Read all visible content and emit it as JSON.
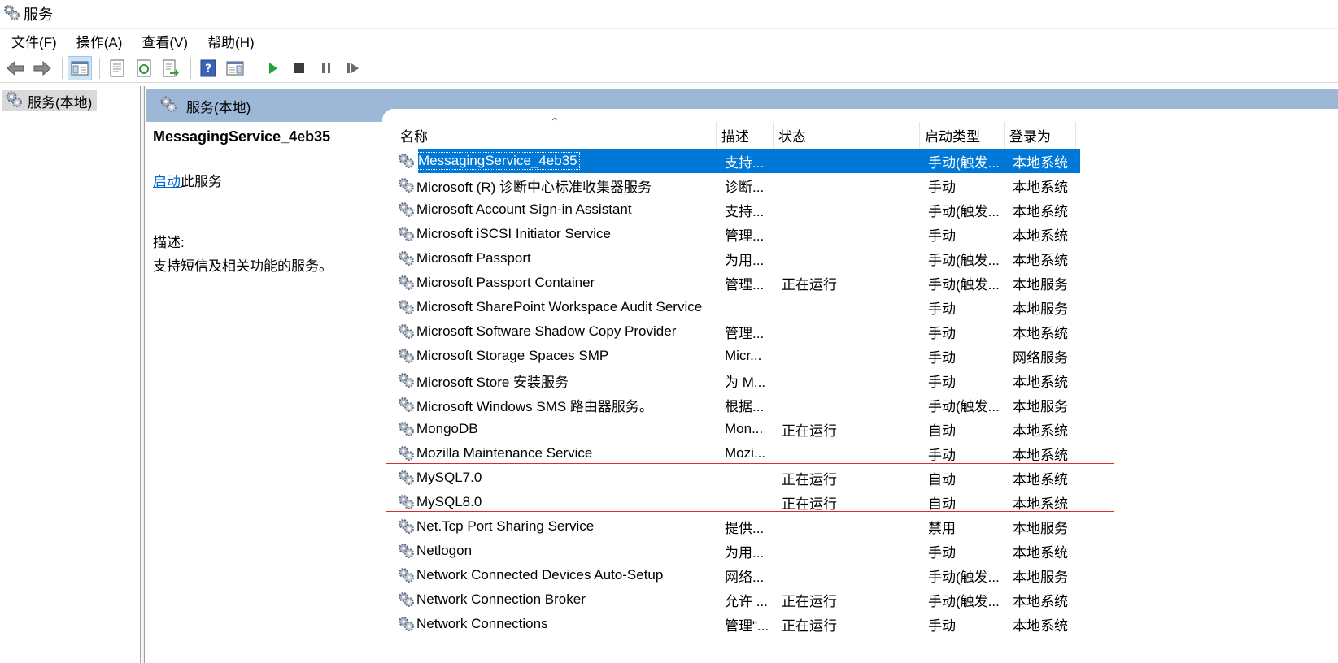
{
  "window": {
    "title": "服务"
  },
  "menu": [
    "文件(F)",
    "操作(A)",
    "查看(V)",
    "帮助(H)"
  ],
  "toolbar": [
    {
      "icon": "back-arrow-icon"
    },
    {
      "icon": "forward-arrow-icon"
    },
    {
      "icon": "show-hide-console-tree-icon"
    },
    {
      "icon": "properties-icon"
    },
    {
      "icon": "refresh-icon"
    },
    {
      "icon": "export-list-icon"
    },
    {
      "icon": "help-icon"
    },
    {
      "icon": "show-action-pane-icon"
    },
    {
      "icon": "start-service-icon"
    },
    {
      "icon": "stop-service-icon"
    },
    {
      "icon": "pause-service-icon"
    },
    {
      "icon": "restart-service-icon"
    }
  ],
  "tree": {
    "item": "服务(本地)"
  },
  "pane": {
    "header": "服务(本地)",
    "selected_name": "MessagingService_4eb35",
    "action_link": "启动",
    "action_rest": "此服务",
    "desc_label": "描述:",
    "desc_text": "支持短信及相关功能的服务。"
  },
  "columns": {
    "name": "名称",
    "desc": "描述",
    "status": "状态",
    "startup": "启动类型",
    "logon": "登录为",
    "sort": "⌃"
  },
  "rows": [
    {
      "name": "MessagingService_4eb35",
      "desc": "支持...",
      "status": "",
      "startup": "手动(触发...",
      "logon": "本地系统",
      "selected": true
    },
    {
      "name": "Microsoft (R) 诊断中心标准收集器服务",
      "desc": "诊断...",
      "status": "",
      "startup": "手动",
      "logon": "本地系统"
    },
    {
      "name": "Microsoft Account Sign-in Assistant",
      "desc": "支持...",
      "status": "",
      "startup": "手动(触发...",
      "logon": "本地系统"
    },
    {
      "name": "Microsoft iSCSI Initiator Service",
      "desc": "管理...",
      "status": "",
      "startup": "手动",
      "logon": "本地系统"
    },
    {
      "name": "Microsoft Passport",
      "desc": "为用...",
      "status": "",
      "startup": "手动(触发...",
      "logon": "本地系统"
    },
    {
      "name": "Microsoft Passport Container",
      "desc": "管理...",
      "status": "正在运行",
      "startup": "手动(触发...",
      "logon": "本地服务"
    },
    {
      "name": "Microsoft SharePoint Workspace Audit Service",
      "desc": "",
      "status": "",
      "startup": "手动",
      "logon": "本地服务"
    },
    {
      "name": "Microsoft Software Shadow Copy Provider",
      "desc": "管理...",
      "status": "",
      "startup": "手动",
      "logon": "本地系统"
    },
    {
      "name": "Microsoft Storage Spaces SMP",
      "desc": "Micr...",
      "status": "",
      "startup": "手动",
      "logon": "网络服务"
    },
    {
      "name": "Microsoft Store 安装服务",
      "desc": "为 M...",
      "status": "",
      "startup": "手动",
      "logon": "本地系统"
    },
    {
      "name": "Microsoft Windows SMS 路由器服务。",
      "desc": "根据...",
      "status": "",
      "startup": "手动(触发...",
      "logon": "本地服务"
    },
    {
      "name": "MongoDB",
      "desc": "Mon...",
      "status": "正在运行",
      "startup": "自动",
      "logon": "本地系统"
    },
    {
      "name": "Mozilla Maintenance Service",
      "desc": "Mozi...",
      "status": "",
      "startup": "手动",
      "logon": "本地系统"
    },
    {
      "name": "MySQL7.0",
      "desc": "",
      "status": "正在运行",
      "startup": "自动",
      "logon": "本地系统"
    },
    {
      "name": "MySQL8.0",
      "desc": "",
      "status": "正在运行",
      "startup": "自动",
      "logon": "本地系统"
    },
    {
      "name": "Net.Tcp Port Sharing Service",
      "desc": "提供...",
      "status": "",
      "startup": "禁用",
      "logon": "本地服务"
    },
    {
      "name": "Netlogon",
      "desc": "为用...",
      "status": "",
      "startup": "手动",
      "logon": "本地系统"
    },
    {
      "name": "Network Connected Devices Auto-Setup",
      "desc": "网络...",
      "status": "",
      "startup": "手动(触发...",
      "logon": "本地服务"
    },
    {
      "name": "Network Connection Broker",
      "desc": "允许 ...",
      "status": "正在运行",
      "startup": "手动(触发...",
      "logon": "本地系统"
    },
    {
      "name": "Network Connections",
      "desc": "管理\"...",
      "status": "正在运行",
      "startup": "手动",
      "logon": "本地系统"
    }
  ],
  "colors": {
    "selection": "#0078d7",
    "header": "#9db7d6",
    "highlight": "#e0272a",
    "link": "#0066cc"
  }
}
